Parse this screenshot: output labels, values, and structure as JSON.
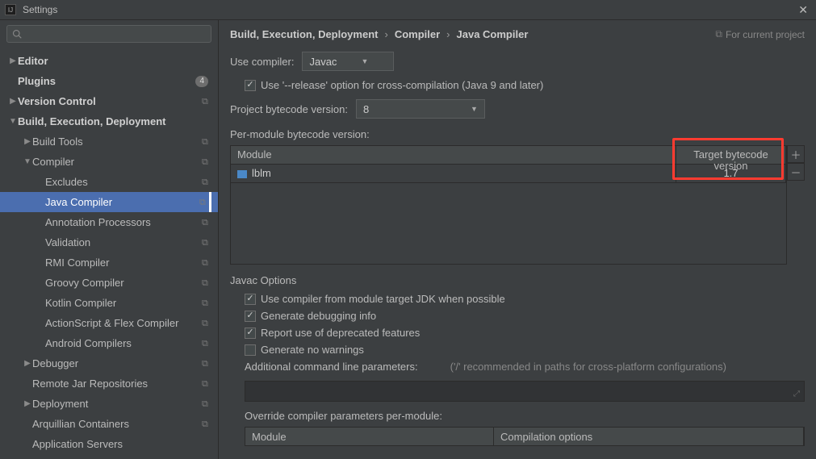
{
  "window": {
    "title": "Settings"
  },
  "sidebar": {
    "items": [
      {
        "label": "Editor",
        "level": 0,
        "arrow": "▶",
        "bold": true
      },
      {
        "label": "Plugins",
        "level": 0,
        "arrow": "",
        "bold": true,
        "badge": "4"
      },
      {
        "label": "Version Control",
        "level": 0,
        "arrow": "▶",
        "bold": true,
        "copy": true
      },
      {
        "label": "Build, Execution, Deployment",
        "level": 0,
        "arrow": "▼",
        "bold": true
      },
      {
        "label": "Build Tools",
        "level": 1,
        "arrow": "▶",
        "copy": true
      },
      {
        "label": "Compiler",
        "level": 1,
        "arrow": "▼",
        "copy": true
      },
      {
        "label": "Excludes",
        "level": 2,
        "copy": true
      },
      {
        "label": "Java Compiler",
        "level": 2,
        "copy": true,
        "selected": true
      },
      {
        "label": "Annotation Processors",
        "level": 2,
        "copy": true
      },
      {
        "label": "Validation",
        "level": 2,
        "copy": true
      },
      {
        "label": "RMI Compiler",
        "level": 2,
        "copy": true
      },
      {
        "label": "Groovy Compiler",
        "level": 2,
        "copy": true
      },
      {
        "label": "Kotlin Compiler",
        "level": 2,
        "copy": true
      },
      {
        "label": "ActionScript & Flex Compiler",
        "level": 2,
        "copy": true
      },
      {
        "label": "Android Compilers",
        "level": 2,
        "copy": true
      },
      {
        "label": "Debugger",
        "level": 1,
        "arrow": "▶",
        "copy": true
      },
      {
        "label": "Remote Jar Repositories",
        "level": 1,
        "copy": true
      },
      {
        "label": "Deployment",
        "level": 1,
        "arrow": "▶",
        "copy": true
      },
      {
        "label": "Arquillian Containers",
        "level": 1,
        "copy": true
      },
      {
        "label": "Application Servers",
        "level": 1
      }
    ]
  },
  "breadcrumb": [
    "Build, Execution, Deployment",
    "Compiler",
    "Java Compiler"
  ],
  "for_project_label": "For current project",
  "compiler": {
    "use_compiler_label": "Use compiler:",
    "use_compiler_value": "Javac",
    "release_option_label": "Use '--release' option for cross-compilation (Java 9 and later)",
    "project_bytecode_label": "Project bytecode version:",
    "project_bytecode_value": "8",
    "per_module_label": "Per-module bytecode version:",
    "table": {
      "col_module": "Module",
      "col_target": "Target bytecode version",
      "rows": [
        {
          "module": "lblm",
          "target": "1.7"
        }
      ]
    }
  },
  "javac": {
    "section_title": "Javac Options",
    "opt1": "Use compiler from module target JDK when possible",
    "opt2": "Generate debugging info",
    "opt3": "Report use of deprecated features",
    "opt4": "Generate no warnings",
    "cmdline_label": "Additional command line parameters:",
    "cmdline_note": "('/' recommended in paths for cross-platform configurations)",
    "override_label": "Override compiler parameters per-module:",
    "override_table": {
      "col_module": "Module",
      "col_options": "Compilation options"
    }
  }
}
